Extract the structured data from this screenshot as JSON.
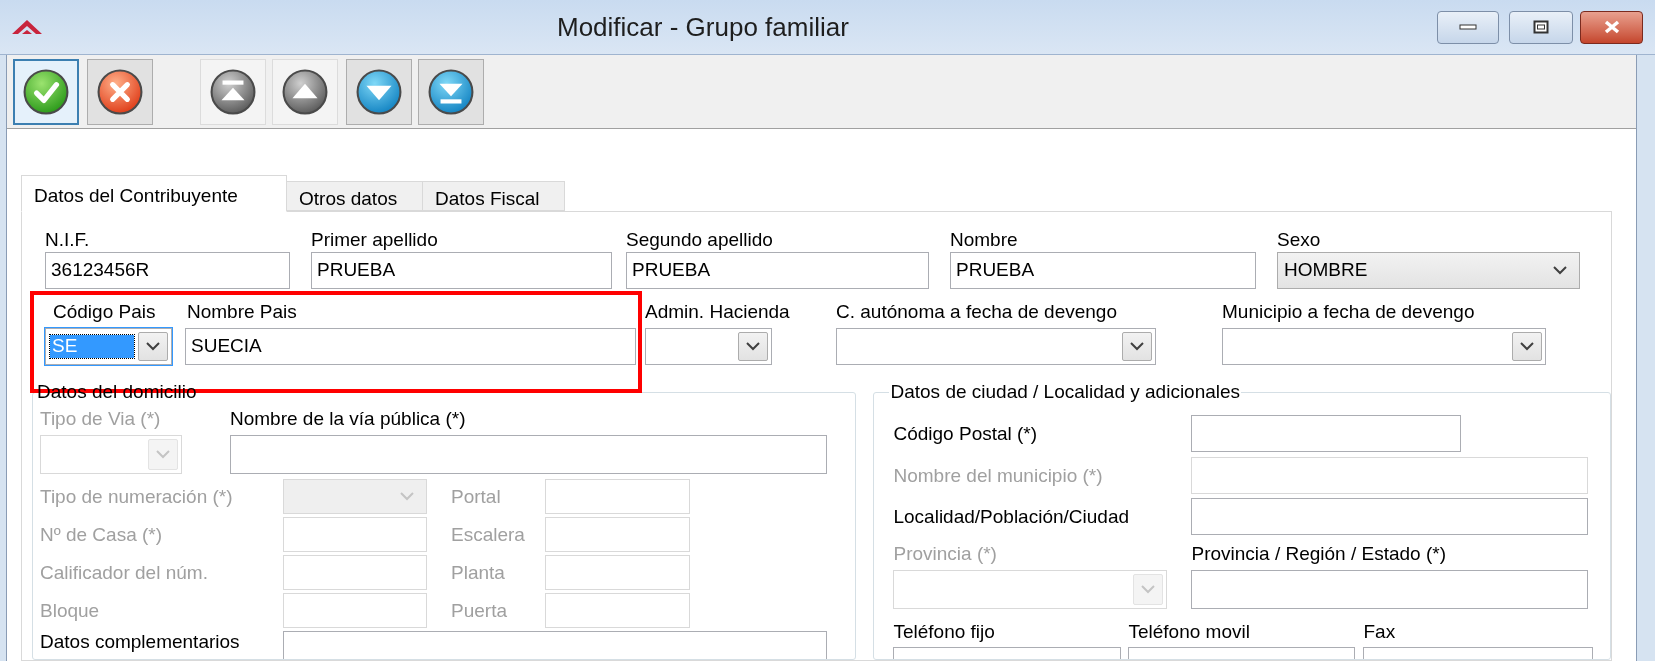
{
  "window": {
    "title": "Modificar - Grupo familiar"
  },
  "toolbar": [
    {
      "kind": "accept",
      "focused": true,
      "disabled": false
    },
    {
      "kind": "cancel",
      "focused": false,
      "disabled": false
    },
    {
      "kind": "first",
      "focused": false,
      "disabled": true
    },
    {
      "kind": "previous",
      "focused": false,
      "disabled": true
    },
    {
      "kind": "next",
      "focused": false,
      "disabled": false
    },
    {
      "kind": "last",
      "focused": false,
      "disabled": false
    }
  ],
  "tabs": [
    {
      "label": "Datos del Contribuyente",
      "selected": true
    },
    {
      "label": "Otros datos",
      "selected": false
    },
    {
      "label": "Datos Fiscal",
      "selected": false
    }
  ],
  "header_fields": [
    {
      "label": "N.I.F.",
      "value": "36123456R",
      "kind": "text",
      "focused": false
    },
    {
      "label": "Primer apellido",
      "value": "PRUEBA",
      "kind": "text",
      "focused": false
    },
    {
      "label": "Segundo apellido",
      "value": "PRUEBA",
      "kind": "text",
      "focused": false
    },
    {
      "label": "Nombre",
      "value": "PRUEBA",
      "kind": "text",
      "focused": false
    },
    {
      "label": "Sexo",
      "value": "HOMBRE",
      "kind": "select",
      "focused": false
    },
    {
      "label": "Código Pais",
      "value": "SE",
      "kind": "combo",
      "focused": true
    },
    {
      "label": "Nombre Pais",
      "value": "SUECIA",
      "kind": "text",
      "focused": false
    },
    {
      "label": "Admin. Hacienda",
      "kind": "combo",
      "focused": false
    },
    {
      "label": "C. autónoma a fecha de devengo",
      "kind": "combo",
      "focused": false
    },
    {
      "label": "Municipio a fecha de devengo",
      "kind": "combo",
      "focused": false
    }
  ],
  "domicilio": {
    "title": "Datos del domicilio",
    "fields": [
      {
        "label": "Tipo de Via (*)",
        "kind": "combo",
        "disabled": true
      },
      {
        "label": "Nombre de la vía pública (*)",
        "kind": "text",
        "disabled": false
      },
      {
        "label": "Tipo de numeración (*)",
        "kind": "select",
        "disabled": true
      },
      {
        "label": "Portal",
        "kind": "text",
        "disabled": true
      },
      {
        "label": "Nº de Casa (*)",
        "kind": "text",
        "disabled": true
      },
      {
        "label": "Escalera",
        "kind": "text",
        "disabled": true
      },
      {
        "label": "Calificador del núm.",
        "kind": "text",
        "disabled": true
      },
      {
        "label": "Planta",
        "kind": "text",
        "disabled": true
      },
      {
        "label": "Bloque",
        "kind": "text",
        "disabled": true
      },
      {
        "label": "Puerta",
        "kind": "text",
        "disabled": true
      },
      {
        "label": "Datos complementarios",
        "kind": "text",
        "disabled": false
      }
    ]
  },
  "ciudad": {
    "title": "Datos de ciudad / Localidad y adicionales",
    "fields": [
      {
        "label": "Código Postal (*)",
        "kind": "text",
        "disabled": false
      },
      {
        "label": "Nombre del municipio (*)",
        "kind": "text",
        "disabled": true
      },
      {
        "label": "Localidad/Población/Ciudad",
        "kind": "text",
        "disabled": false
      },
      {
        "label": "Provincia (*)",
        "kind": "combo",
        "disabled": true
      },
      {
        "label": "Provincia / Región / Estado (*)",
        "kind": "text",
        "disabled": false
      },
      {
        "label": "Teléfono fijo",
        "kind": "text",
        "disabled": false
      },
      {
        "label": "Teléfono movil",
        "kind": "text",
        "disabled": false
      },
      {
        "label": "Fax",
        "kind": "text",
        "disabled": false
      }
    ]
  }
}
